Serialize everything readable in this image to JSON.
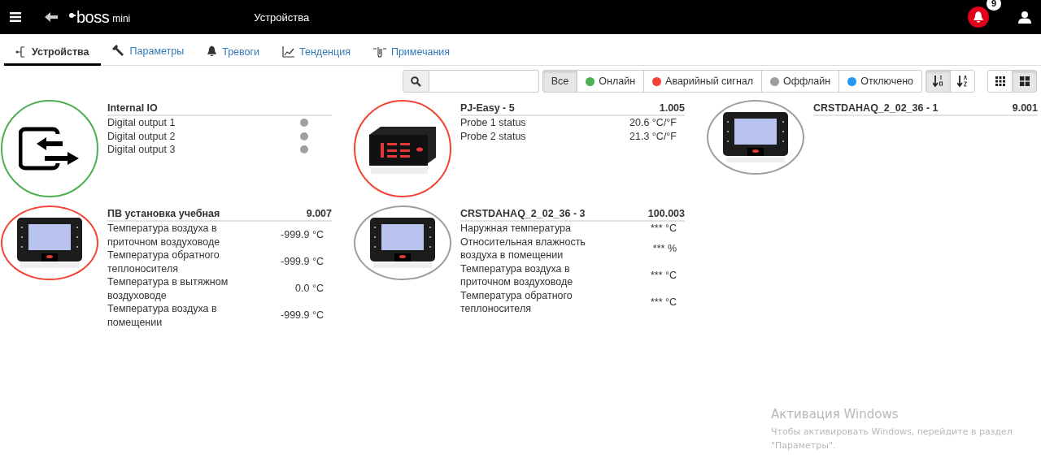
{
  "header": {
    "logo": {
      "main": "boss",
      "sub": "mini"
    },
    "title": "Устройства",
    "notifications": "9"
  },
  "tabs": [
    {
      "label": "Устройства",
      "kind": "tree",
      "selected": true
    },
    {
      "label": "Параметры",
      "kind": "wrench",
      "selected": false
    },
    {
      "label": "Тревоги",
      "kind": "bell",
      "selected": false
    },
    {
      "label": "Тенденция",
      "kind": "chart",
      "selected": false
    },
    {
      "label": "Примечания",
      "kind": "clip",
      "selected": false
    }
  ],
  "filters": [
    {
      "label": "Все",
      "selected": true
    },
    {
      "label": "Онлайн",
      "color": "#4caf50",
      "selected": false
    },
    {
      "label": "Аварийный сигнал",
      "color": "#f44336",
      "selected": false
    },
    {
      "label": "Оффлайн",
      "color": "#9e9e9e",
      "selected": false
    },
    {
      "label": "Отключено",
      "color": "#2196f3",
      "selected": false
    }
  ],
  "sort": [
    {
      "kind": "numeric",
      "selected": true
    },
    {
      "kind": "alpha",
      "selected": false
    }
  ],
  "view": [
    {
      "kind": "small",
      "selected": false
    },
    {
      "kind": "large",
      "selected": true
    }
  ],
  "devices": [
    {
      "name": "Internal IO",
      "color": "#4caf50",
      "kind": "io",
      "rows": [
        {
          "label": "Digital output 1",
          "kind": "dot",
          "on": false
        },
        {
          "label": "Digital output 2",
          "kind": "dot",
          "on": false
        },
        {
          "label": "Digital output 3",
          "kind": "dot",
          "on": false
        }
      ]
    },
    {
      "name": "PJ-Easy - 5",
      "address": "1.005",
      "color": "#f44336",
      "kind": "controller",
      "rows": [
        {
          "label": "Probe 1 status",
          "kind": "value",
          "value": "20.6 °C/°F"
        },
        {
          "label": "Probe 2 status",
          "kind": "value",
          "value": "21.3 °C/°F"
        }
      ]
    },
    {
      "name": "CRSTDAHAQ_2_02_36 - 1",
      "address": "9.001",
      "color": "#9e9e9e",
      "kind": "display"
    },
    {
      "name": "ПВ установка учебная",
      "address": "9.007",
      "color": "#f44336",
      "kind": "display",
      "rows": [
        {
          "label": "Температура воздуха в приточном воздуховоде",
          "kind": "value",
          "value": "-999.9 °C"
        },
        {
          "label": "Температура обратного теплоносителя",
          "kind": "value",
          "value": "-999.9 °C"
        },
        {
          "label": "Температура в вытяжном воздуховоде",
          "kind": "value",
          "value": "0.0 °C"
        },
        {
          "label": "Температура воздуха в помещении",
          "kind": "value",
          "value": "-999.9 °C"
        }
      ]
    },
    {
      "name": "CRSTDAHAQ_2_02_36 - 3",
      "address": "100.003",
      "color": "#9e9e9e",
      "kind": "display",
      "rows": [
        {
          "label": "Наружная температура",
          "kind": "value",
          "value": "*** °C"
        },
        {
          "label": "Относительная влажность воздуха в помещении",
          "kind": "value",
          "value": "*** %"
        },
        {
          "label": "Температура воздуха в приточном воздуховоде",
          "kind": "value",
          "value": "*** °C"
        },
        {
          "label": "Температура обратного теплоносителя",
          "kind": "value",
          "value": "*** °C"
        }
      ]
    }
  ],
  "activation": {
    "title": "Активация Windows",
    "text": "Чтобы активировать Windows, перейдите в раздел \"Параметры\"."
  }
}
